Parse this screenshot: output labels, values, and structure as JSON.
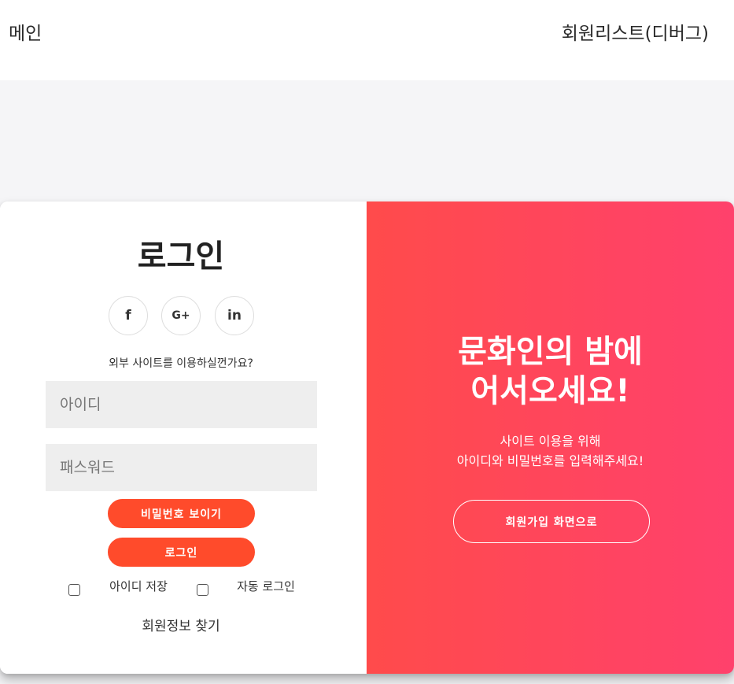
{
  "nav": {
    "main_label": "메인",
    "members_label": "회원리스트(디버그)"
  },
  "login": {
    "title": "로그인",
    "social": [
      {
        "icon": "facebook-icon",
        "glyph": "f"
      },
      {
        "icon": "google-plus-icon",
        "glyph": "G+"
      },
      {
        "icon": "linkedin-icon",
        "glyph": "in"
      }
    ],
    "external_prompt": "외부 사이트를 이용하실껀가요?",
    "id_placeholder": "아이디",
    "password_placeholder": "패스워드",
    "show_password_label": "비밀번호 보이기",
    "login_button_label": "로그인",
    "save_id_label": "아이디 저장",
    "auto_login_label": "자동 로그인",
    "find_account_label": "회원정보 찾기"
  },
  "welcome": {
    "title_line1": "문화인의 밤에",
    "title_line2": "어서오세요!",
    "sub_line1": "사이트 이용을 위해",
    "sub_line2": "아이디와 비밀번호를 입력해주세요!",
    "signup_button_label": "회원가입 화면으로"
  },
  "colors": {
    "accent": "#ff4b2b",
    "gradient_start": "#ff4b4b",
    "gradient_end": "#ff416c",
    "input_bg": "#eeeeee",
    "page_bg": "#f5f5f7"
  }
}
